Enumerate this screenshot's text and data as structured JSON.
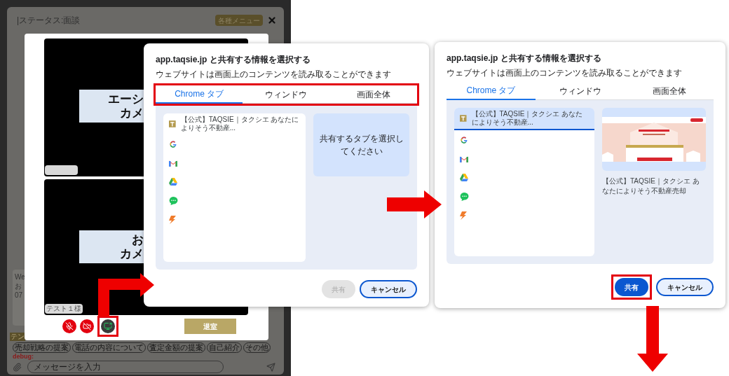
{
  "app": {
    "status_title": "|ステータス:面談",
    "menu_button": "各種メニュー",
    "chat_lines": [
      "We",
      "お",
      "07"
    ],
    "template_label": "テン",
    "template_chips": [
      "売却戦略の提案",
      "電話の内容について",
      "査定金額の提案",
      "自己紹介",
      "その他"
    ],
    "debug_label": "debug:",
    "message_placeholder": "メッセージを入力"
  },
  "video_modal": {
    "tiles": [
      {
        "label_lines": [
          "エーシ",
          "カメ"
        ],
        "has_name_tag": true
      },
      {
        "label_lines": [
          "お",
          "カメ"
        ],
        "has_name_tag": true,
        "name_tag": "テスト１様"
      }
    ],
    "controls": [
      {
        "kind": "mic",
        "on": false,
        "highlighted": false
      },
      {
        "kind": "camera",
        "on": false,
        "highlighted": false
      },
      {
        "kind": "screen_share",
        "on": true,
        "highlighted": true
      }
    ],
    "leave_button": "退室"
  },
  "dialogs": [
    {
      "title": "app.taqsie.jp と共有する情報を選択する",
      "subtitle": "ウェブサイトは画面上のコンテンツを読み取ることができます",
      "tabs_highlighted": true,
      "tabs": [
        {
          "label": "Chrome タブ",
          "selected": true
        },
        {
          "label": "ウィンドウ",
          "selected": false
        },
        {
          "label": "画面全体",
          "selected": false
        }
      ],
      "tab_items": [
        {
          "kind": "site",
          "title": "【公式】TAQSIE｜タクシエ あなたによりそう不動産...",
          "selected": false
        },
        {
          "kind": "google",
          "selected": false
        },
        {
          "kind": "gmail",
          "selected": false
        },
        {
          "kind": "drive",
          "selected": false
        },
        {
          "kind": "messages",
          "selected": false
        },
        {
          "kind": "bolt",
          "selected": false
        }
      ],
      "preview": {
        "kind": "placeholder",
        "text": "共有するタブを選択してください"
      },
      "buttons": [
        {
          "label": "共有",
          "kind": "primary",
          "disabled": true,
          "highlighted": false
        },
        {
          "label": "キャンセル",
          "kind": "secondary",
          "disabled": false,
          "highlighted": false
        }
      ]
    },
    {
      "title": "app.taqsie.jp と共有する情報を選択する",
      "subtitle": "ウェブサイトは画面上のコンテンツを読み取ることができます",
      "tabs_highlighted": false,
      "tabs": [
        {
          "label": "Chrome タブ",
          "selected": true
        },
        {
          "label": "ウィンドウ",
          "selected": false
        },
        {
          "label": "画面全体",
          "selected": false
        }
      ],
      "tab_items": [
        {
          "kind": "site",
          "title": "【公式】TAQSIE｜タクシエ あなたによりそう不動産...",
          "selected": true
        },
        {
          "kind": "google",
          "selected": false
        },
        {
          "kind": "gmail",
          "selected": false
        },
        {
          "kind": "drive",
          "selected": false
        },
        {
          "kind": "messages",
          "selected": false
        },
        {
          "kind": "bolt",
          "selected": false
        }
      ],
      "preview": {
        "kind": "picture",
        "caption": "【公式】TAQSIE｜タクシエ あなたによりそう不動産売却"
      },
      "buttons": [
        {
          "label": "共有",
          "kind": "primary",
          "disabled": false,
          "highlighted": true
        },
        {
          "label": "キャンセル",
          "kind": "secondary",
          "disabled": false,
          "highlighted": false
        }
      ]
    }
  ]
}
